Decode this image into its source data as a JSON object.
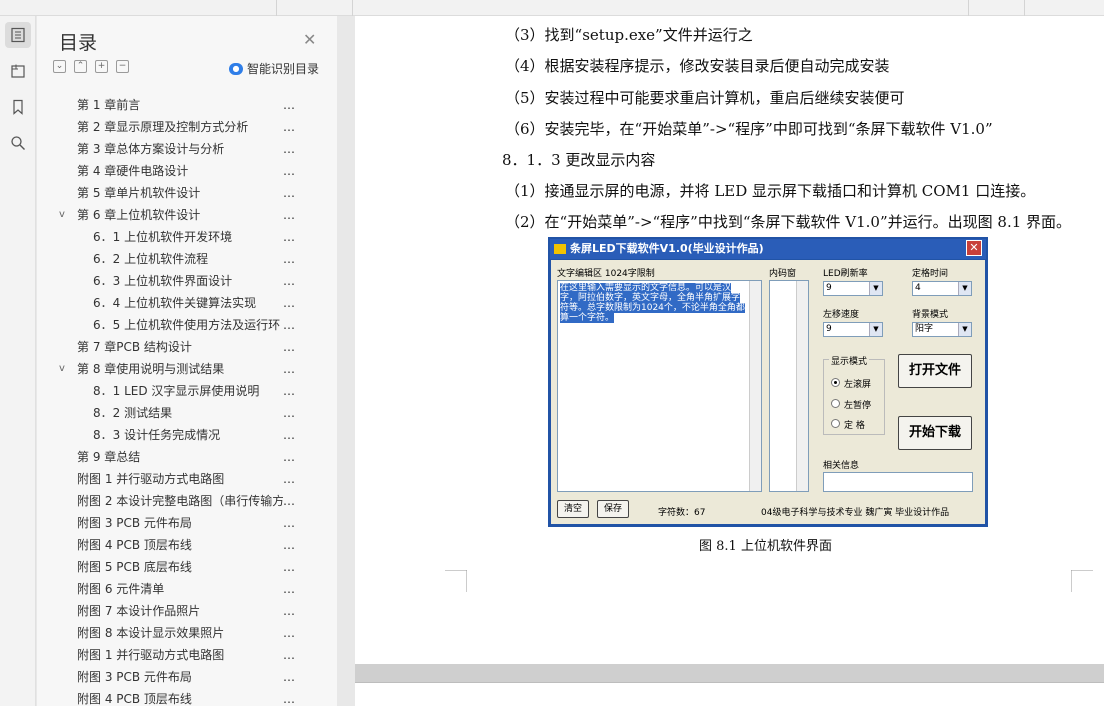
{
  "sidebar": {
    "title": "目录",
    "smart_toc_label": "智能识别目录",
    "items": [
      {
        "text": "第 1 章前言",
        "level": 1,
        "expand": ""
      },
      {
        "text": "第 2 章显示原理及控制方式分析",
        "level": 1,
        "expand": ""
      },
      {
        "text": "第 3 章总体方案设计与分析",
        "level": 1,
        "expand": ""
      },
      {
        "text": "第 4 章硬件电路设计",
        "level": 1,
        "expand": ""
      },
      {
        "text": "第 5 章单片机软件设计",
        "level": 1,
        "expand": ""
      },
      {
        "text": "第 6 章上位机软件设计",
        "level": 1,
        "expand": "v"
      },
      {
        "text": "6．1 上位机软件开发环境",
        "level": 2,
        "expand": ""
      },
      {
        "text": "6．2 上位机软件流程",
        "level": 2,
        "expand": ""
      },
      {
        "text": "6．3 上位机软件界面设计",
        "level": 2,
        "expand": ""
      },
      {
        "text": "6．4 上位机软件关键算法实现",
        "level": 2,
        "expand": ""
      },
      {
        "text": "6．5 上位机软件使用方法及运行环",
        "level": 2,
        "expand": ""
      },
      {
        "text": "第 7 章PCB 结构设计",
        "level": 1,
        "expand": ""
      },
      {
        "text": "第 8 章使用说明与测试结果",
        "level": 1,
        "expand": "v"
      },
      {
        "text": "8．1  LED 汉字显示屏使用说明",
        "level": 2,
        "expand": ""
      },
      {
        "text": "8．2 测试结果",
        "level": 2,
        "expand": ""
      },
      {
        "text": "8．3 设计任务完成情况",
        "level": 2,
        "expand": ""
      },
      {
        "text": "第 9 章总结",
        "level": 1,
        "expand": ""
      },
      {
        "text": "附图 1 并行驱动方式电路图",
        "level": 1,
        "expand": ""
      },
      {
        "text": "附图 2 本设计完整电路图（串行传输方",
        "level": 1,
        "expand": ""
      },
      {
        "text": "附图 3   PCB 元件布局",
        "level": 1,
        "expand": ""
      },
      {
        "text": "附图 4   PCB 顶层布线",
        "level": 1,
        "expand": ""
      },
      {
        "text": "附图 5   PCB 底层布线",
        "level": 1,
        "expand": ""
      },
      {
        "text": "附图 6 元件清单",
        "level": 1,
        "expand": ""
      },
      {
        "text": "附图 7 本设计作品照片",
        "level": 1,
        "expand": ""
      },
      {
        "text": "附图 8 本设计显示效果照片",
        "level": 1,
        "expand": ""
      },
      {
        "text": "附图 1   并行驱动方式电路图",
        "level": 1,
        "expand": ""
      },
      {
        "text": "附图 3   PCB 元件布局",
        "level": 1,
        "expand": ""
      },
      {
        "text": "附图 4   PCB 顶层布线",
        "level": 1,
        "expand": ""
      }
    ]
  },
  "document": {
    "lines": [
      "（3）找到“setup.exe”文件并运行之",
      "（4）根据安装程序提示，修改安装目录后便自动完成安装",
      "（5）安装过程中可能要求重启计算机，重启后继续安装便可",
      "（6）安装完毕，在“开始菜单”->“程序”中即可找到“条屏下载软件 V1.0”",
      "8．1．3 更改显示内容",
      "（1）接通显示屏的电源，并将 LED 显示屏下载插口和计算机 COM1 口连接。",
      "（2）在“开始菜单”->“程序”中找到“条屏下载软件 V1.0”并运行。出现图 8.1 界面。"
    ],
    "caption": "图 8.1 上位机软件界面"
  },
  "app": {
    "title": "条屏LED下载软件V1.0(毕业设计作品)",
    "edit_label": "文字编辑区  1024字限制",
    "code_label": "内码窗",
    "edit_text": "在这里输入需要显示的文字信息。可以是汉字，阿拉伯数字，英文字母，全角半角扩展字符等。总字数限制为1024个，不论半角全角都算一个字符。",
    "refresh_label": "LED刷新率",
    "refresh_value": "9",
    "hold_label": "定格时间",
    "hold_value": "4",
    "speed_label": "左移速度",
    "speed_value": "9",
    "bg_label": "背景模式",
    "bg_value": "阳字",
    "mode_label": "显示模式",
    "mode_scroll": "左滚屏",
    "mode_pause": "左暂停",
    "mode_fixed": "定  格",
    "open_button": "打开文件",
    "download_button": "开始下载",
    "info_label": "相关信息",
    "clear_button": "清空",
    "save_button": "保存",
    "char_count": "字符数：67",
    "footer": "04级电子科学与技术专业 魏广寅 毕业设计作品"
  }
}
